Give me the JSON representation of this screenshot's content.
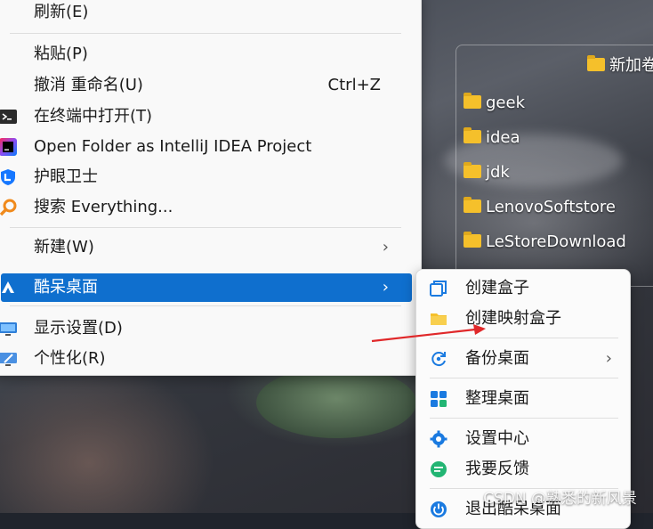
{
  "desktop": {
    "folder_top": "新加卷",
    "folders": [
      "geek",
      "idea",
      "jdk",
      "LenovoSoftstore",
      "LeStoreDownload"
    ]
  },
  "context_menu": {
    "items": [
      {
        "label": "刷新(E)"
      },
      {
        "label": "粘贴(P)"
      },
      {
        "label": "撤消 重命名(U)",
        "shortcut": "Ctrl+Z"
      },
      {
        "label": "在终端中打开(T)",
        "icon": "terminal-icon"
      },
      {
        "label": "Open Folder as IntelliJ IDEA Project",
        "icon": "intellij-idea-icon"
      },
      {
        "label": "护眼卫士",
        "icon": "eye-guard-icon"
      },
      {
        "label": "搜索 Everything...",
        "icon": "everything-search-icon"
      },
      {
        "label": "新建(W)",
        "arrow": "›"
      },
      {
        "label": "酷呆桌面",
        "arrow": "›",
        "icon": "kudai-desktop-icon",
        "active": true
      },
      {
        "label": "显示设置(D)",
        "icon": "display-settings-icon"
      },
      {
        "label": "个性化(R)",
        "icon": "personalize-icon"
      }
    ]
  },
  "submenu": {
    "items": [
      {
        "label": "创建盒子",
        "icon": "box-icon"
      },
      {
        "label": "创建映射盒子",
        "icon": "folder-icon"
      },
      {
        "label": "备份桌面",
        "icon": "backup-icon",
        "arrow": "›"
      },
      {
        "label": "整理桌面",
        "icon": "organize-icon"
      },
      {
        "label": "设置中心",
        "icon": "gear-icon"
      },
      {
        "label": "我要反馈",
        "icon": "feedback-icon"
      },
      {
        "label": "退出酷呆桌面",
        "icon": "power-icon"
      }
    ]
  },
  "watermark": "CSDN @熟悉的新风景",
  "colors": {
    "accent": "#0f6fce",
    "folder": "#f5c02b",
    "annotation": "#e0282a"
  }
}
